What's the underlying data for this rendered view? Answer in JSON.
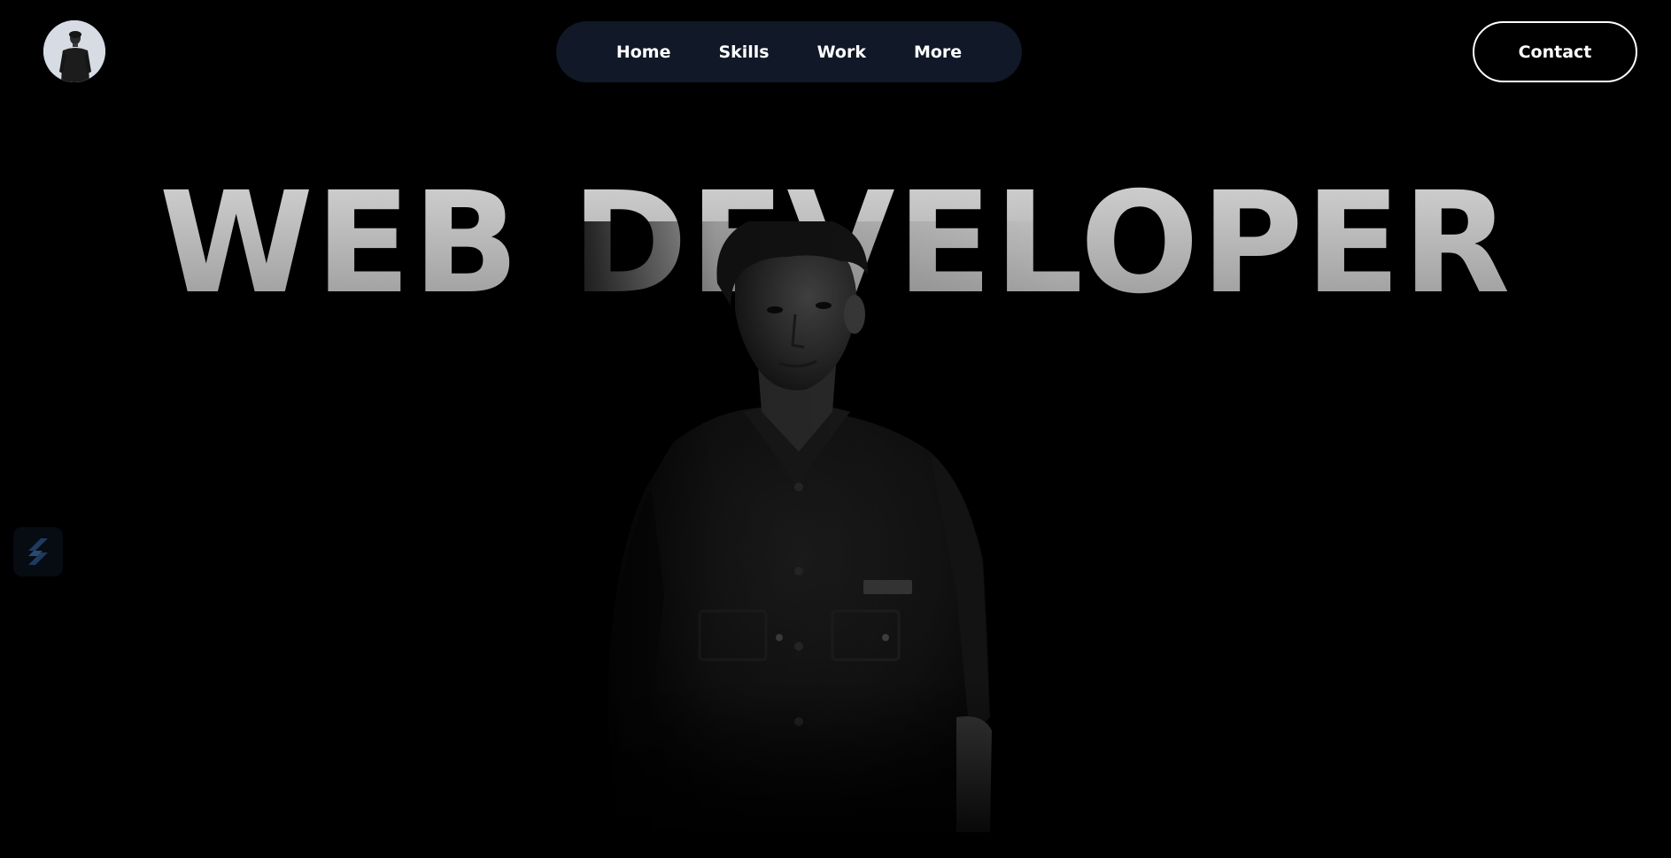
{
  "header": {
    "avatar_icon": "profile-photo-avatar",
    "nav": {
      "items": [
        {
          "label": "Home"
        },
        {
          "label": "Skills"
        },
        {
          "label": "Work"
        },
        {
          "label": "More"
        }
      ]
    },
    "contact_label": "Contact"
  },
  "hero": {
    "headline": "WEB DEVELOPER",
    "portrait_icon": "person-portrait"
  },
  "side_badge": {
    "icon": "slash-logo-icon"
  },
  "colors": {
    "background": "#000000",
    "nav_background": "#111827",
    "text": "#ffffff",
    "headline_top": "#d2d2d2",
    "headline_bottom": "#9a9a9a",
    "badge_accent": "#1e3a5f"
  }
}
